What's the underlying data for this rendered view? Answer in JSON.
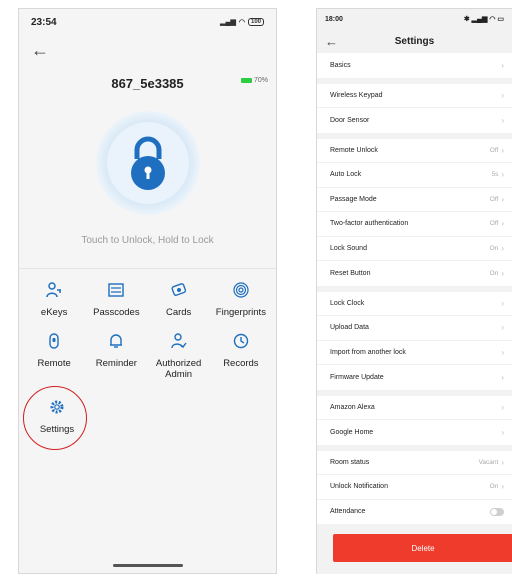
{
  "left": {
    "status_time": "23:54",
    "status_battery": "100",
    "device_name": "867_5e3385",
    "battery_level": "70%",
    "lock_hint": "Touch to Unlock, Hold to Lock",
    "grid": [
      {
        "label": "eKeys",
        "icon": "ekeys-icon"
      },
      {
        "label": "Passcodes",
        "icon": "passcodes-icon"
      },
      {
        "label": "Cards",
        "icon": "cards-icon"
      },
      {
        "label": "Fingerprints",
        "icon": "fingerprint-icon"
      },
      {
        "label": "Remote",
        "icon": "remote-icon"
      },
      {
        "label": "Reminder",
        "icon": "bell-icon"
      },
      {
        "label": "Authorized Admin",
        "icon": "admin-icon"
      },
      {
        "label": "Records",
        "icon": "records-icon"
      }
    ],
    "settings_label": "Settings",
    "accent": "#1e6fc0",
    "highlight": "#d21f1f"
  },
  "right": {
    "status_time": "18:00",
    "title": "Settings",
    "groups": [
      [
        {
          "label": "Basics",
          "value": ""
        }
      ],
      [
        {
          "label": "Wireless Keypad",
          "value": ""
        },
        {
          "label": "Door Sensor",
          "value": ""
        }
      ],
      [
        {
          "label": "Remote Unlock",
          "value": "Off"
        },
        {
          "label": "Auto Lock",
          "value": "5s"
        },
        {
          "label": "Passage Mode",
          "value": "Off"
        },
        {
          "label": "Two-factor authentication",
          "value": "Off"
        },
        {
          "label": "Lock Sound",
          "value": "On"
        },
        {
          "label": "Reset Button",
          "value": "On"
        }
      ],
      [
        {
          "label": "Lock Clock",
          "value": ""
        },
        {
          "label": "Upload Data",
          "value": ""
        },
        {
          "label": "Import from another lock",
          "value": ""
        },
        {
          "label": "Firmware Update",
          "value": ""
        }
      ],
      [
        {
          "label": "Amazon Alexa",
          "value": ""
        },
        {
          "label": "Google Home",
          "value": ""
        }
      ],
      [
        {
          "label": "Room status",
          "value": "Vacant"
        },
        {
          "label": "Unlock Notification",
          "value": "On"
        },
        {
          "label": "Attendance",
          "value": "",
          "toggle": true
        }
      ]
    ],
    "delete_label": "Delete",
    "delete_color": "#ee3b2c"
  }
}
